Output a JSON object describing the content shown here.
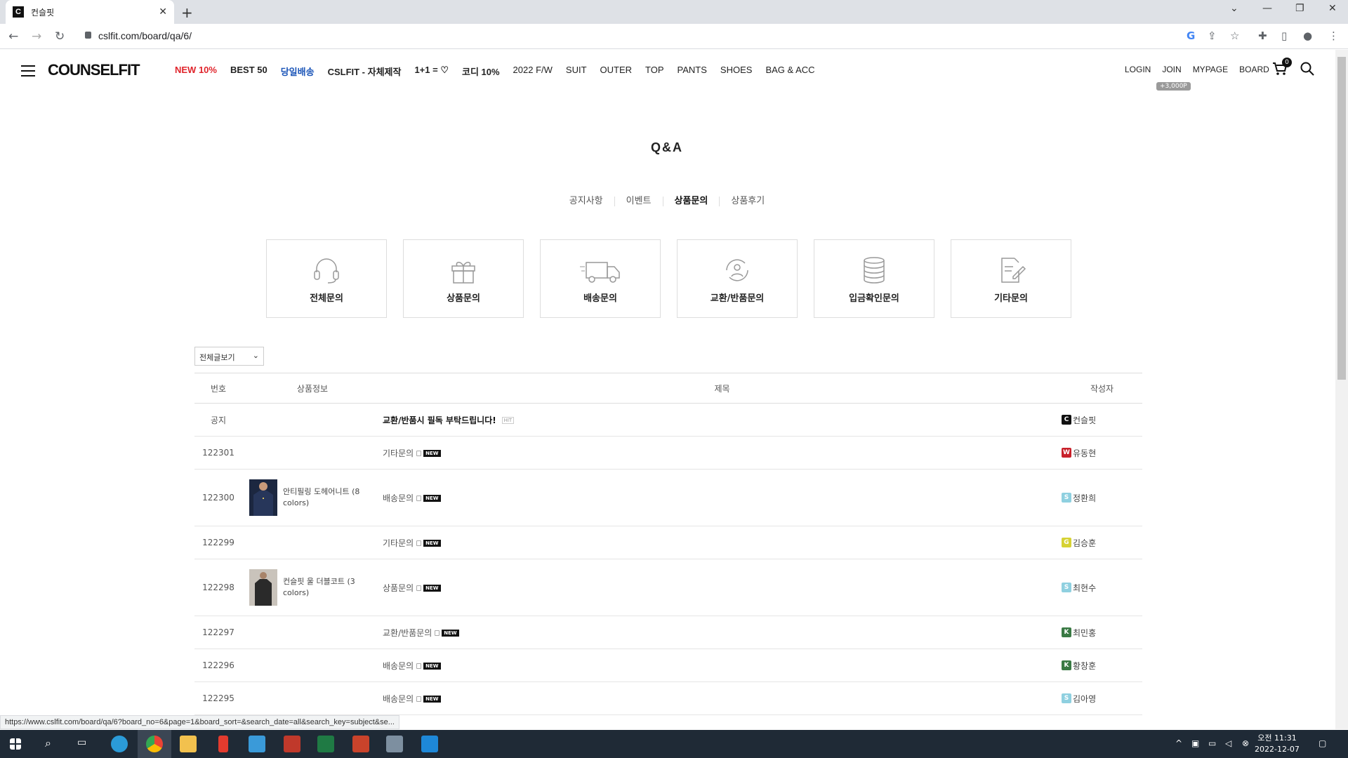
{
  "browser": {
    "tab_title": "컨슬핏",
    "favicon_letter": "C",
    "url": "cslfit.com/board/qa/6/"
  },
  "header": {
    "logo": "COUNSELFIT",
    "nav": [
      {
        "label": "NEW 10%",
        "style": "red"
      },
      {
        "label": "BEST 50",
        "style": "bold"
      },
      {
        "label": "당일배송",
        "style": "blue"
      },
      {
        "label": "CSLFIT - 자체제작",
        "style": "bold"
      },
      {
        "label": "1+1 = ♡",
        "style": "bold"
      },
      {
        "label": "코디 10%",
        "style": "bold"
      },
      {
        "label": "2022 F/W",
        "style": ""
      },
      {
        "label": "SUIT",
        "style": ""
      },
      {
        "label": "OUTER",
        "style": ""
      },
      {
        "label": "TOP",
        "style": ""
      },
      {
        "label": "PANTS",
        "style": ""
      },
      {
        "label": "SHOES",
        "style": ""
      },
      {
        "label": "BAG & ACC",
        "style": ""
      }
    ],
    "login": "LOGIN",
    "join": "JOIN",
    "join_badge": "+3,000P",
    "mypage": "MYPAGE",
    "board": "BOARD",
    "cart_count": "0"
  },
  "page": {
    "title": "Q&A",
    "subtabs": [
      "공지사항",
      "이벤트",
      "상품문의",
      "상품후기"
    ],
    "active_subtab": "상품문의",
    "categories": [
      "전체문의",
      "상품문의",
      "배송문의",
      "교환/반품문의",
      "입금확인문의",
      "기타문의"
    ],
    "filter_select": "전체글보기"
  },
  "table": {
    "headers": {
      "no": "번호",
      "product": "상품정보",
      "title": "제목",
      "writer": "작성자"
    },
    "notice": {
      "no": "공지",
      "title": "교환/반품시 필독 부탁드립니다!",
      "hit": "HIT",
      "writer_badge": "C",
      "writer": "컨슬핏",
      "badge_color": "#111111"
    },
    "new_tag": "NEW",
    "rows": [
      {
        "no": "122301",
        "product": "",
        "title": "기타문의",
        "writer_badge": "W",
        "writer": "유동현",
        "badge_color": "#c8202a"
      },
      {
        "no": "122300",
        "product": "안티필링 도헤어니트 (8 colors)",
        "title": "배송문의",
        "writer_badge": "S",
        "writer": "정환희",
        "badge_color": "#8fd0e0"
      },
      {
        "no": "122299",
        "product": "",
        "title": "기타문의",
        "writer_badge": "G",
        "writer": "김승훈",
        "badge_color": "#d6d233"
      },
      {
        "no": "122298",
        "product": "컨슬핏 울 더블코트 (3 colors)",
        "title": "상품문의",
        "writer_badge": "S",
        "writer": "최현수",
        "badge_color": "#8fd0e0"
      },
      {
        "no": "122297",
        "product": "",
        "title": "교환/반품문의",
        "writer_badge": "K",
        "writer": "최민홍",
        "badge_color": "#3a7a44"
      },
      {
        "no": "122296",
        "product": "",
        "title": "배송문의",
        "writer_badge": "K",
        "writer": "황창훈",
        "badge_color": "#3a7a44"
      },
      {
        "no": "122295",
        "product": "",
        "title": "배송문의",
        "writer_badge": "S",
        "writer": "김아영",
        "badge_color": "#8fd0e0"
      }
    ]
  },
  "status_url": "https://www.cslfit.com/board/qa/6?board_no=6&page=1&board_sort=&search_date=all&search_key=subject&se...",
  "taskbar": {
    "time": "오전 11:31",
    "date": "2022-12-07"
  }
}
